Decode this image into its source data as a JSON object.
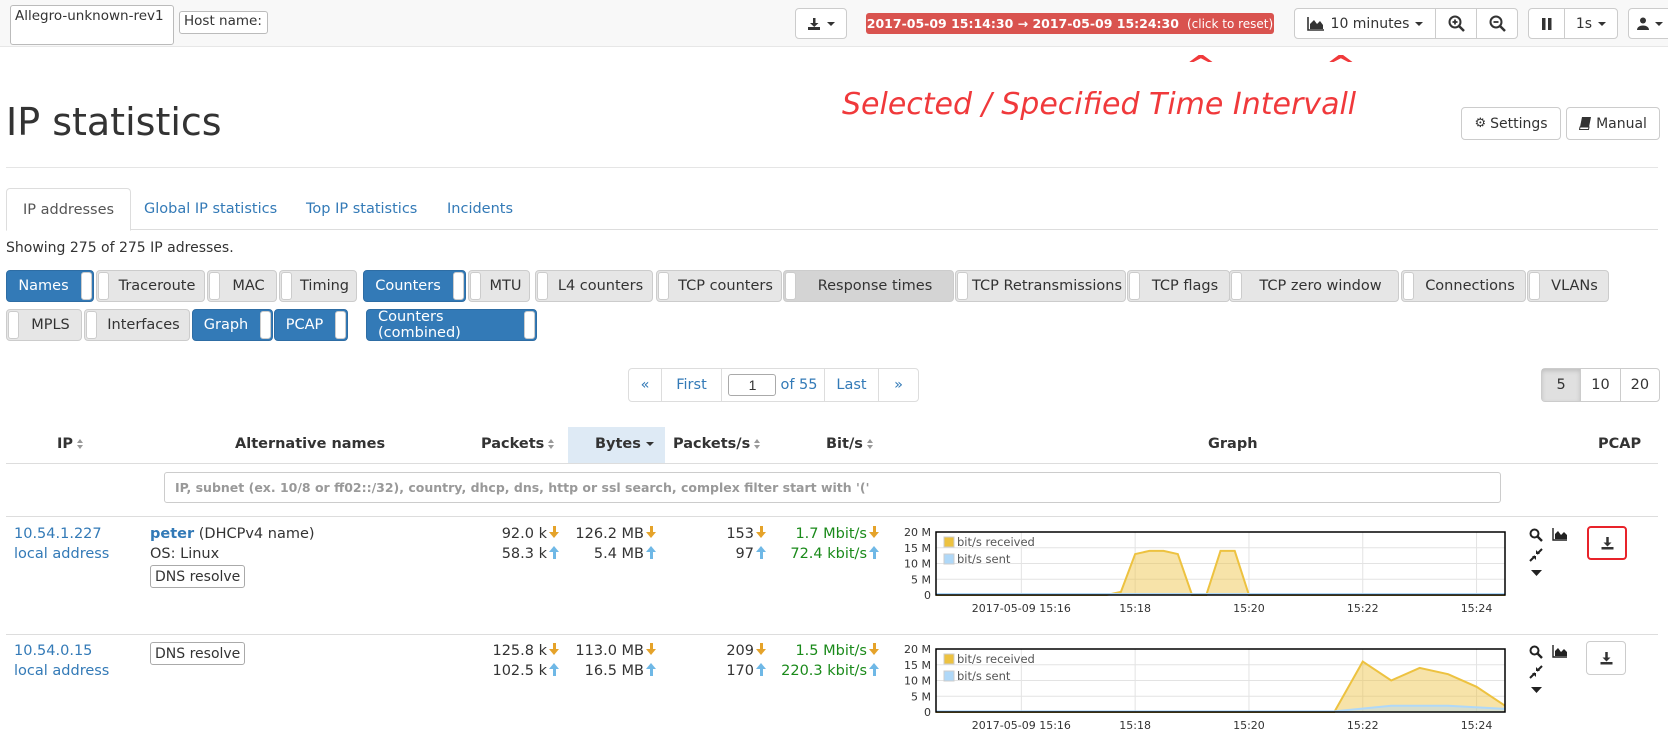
{
  "topbar": {
    "device_name": "Allegro-unknown-rev1",
    "host_name_label": "Host name:",
    "time_range": "2017-05-09 15:14:30 → 2017-05-09 15:24:30",
    "time_range_hint": "(click to reset)",
    "interval_label": "10 minutes",
    "refresh_label": "1s"
  },
  "annotation": {
    "text": "Selected / Specified Time Intervall",
    "caret": "^"
  },
  "header": {
    "title": "IP statistics",
    "settings_label": "Settings",
    "manual_label": "Manual"
  },
  "tabs": [
    {
      "label": "IP addresses",
      "active": true
    },
    {
      "label": "Global IP statistics",
      "active": false
    },
    {
      "label": "Top IP statistics",
      "active": false
    },
    {
      "label": "Incidents",
      "active": false
    }
  ],
  "showing_text": "Showing 275 of 275 IP adresses.",
  "column_toggles": [
    {
      "label": "Names",
      "on": true
    },
    {
      "label": "Traceroute",
      "on": false
    },
    {
      "label": "MAC",
      "on": false
    },
    {
      "label": "Timing",
      "on": false
    },
    {
      "label": "Counters",
      "on": true
    },
    {
      "label": "MTU",
      "on": false
    },
    {
      "label": "L4 counters",
      "on": false
    },
    {
      "label": "TCP counters",
      "on": false
    },
    {
      "label": "Response times",
      "on": false
    },
    {
      "label": "TCP Retransmissions",
      "on": false
    },
    {
      "label": "TCP flags",
      "on": false
    },
    {
      "label": "TCP zero window",
      "on": false
    },
    {
      "label": "Connections",
      "on": false
    },
    {
      "label": "VLANs",
      "on": false
    },
    {
      "label": "MPLS",
      "on": false
    },
    {
      "label": "Interfaces",
      "on": false
    },
    {
      "label": "Graph",
      "on": true
    },
    {
      "label": "PCAP",
      "on": true
    },
    {
      "label": "Counters (combined)",
      "on": true
    }
  ],
  "pagination": {
    "prev": "«",
    "first": "First",
    "current_page": "1",
    "of_text": "of 55",
    "last": "Last",
    "next": "»",
    "page_sizes": [
      "5",
      "10",
      "20"
    ],
    "selected_page_size": "5"
  },
  "table": {
    "headers": {
      "ip": "IP",
      "alt_names": "Alternative names",
      "packets": "Packets",
      "bytes": "Bytes",
      "packets_per_s": "Packets/s",
      "bits_per_s": "Bit/s",
      "graph": "Graph",
      "pcap": "PCAP"
    },
    "filter_placeholder": "IP, subnet (ex. 10/8 or ff02::/32), country, dhcp, dns, http or ssl search, complex filter start with '('",
    "rows": [
      {
        "ip": "10.54.1.227",
        "ip_type": "local address",
        "name": "peter",
        "name_source": "(DHCPv4 name)",
        "os": "OS: Linux",
        "dns_button": "DNS resolve",
        "packets_rx": "92.0 k",
        "packets_tx": "58.3 k",
        "bytes_rx": "126.2 MB",
        "bytes_tx": "5.4 MB",
        "pps_rx": "153",
        "pps_tx": "97",
        "bps_rx": "1.7 Mbit/s",
        "bps_tx": "72.4 kbit/s",
        "pcap_highlighted": true
      },
      {
        "ip": "10.54.0.15",
        "ip_type": "local address",
        "dns_button": "DNS resolve",
        "packets_rx": "125.8 k",
        "packets_tx": "102.5 k",
        "bytes_rx": "113.0 MB",
        "bytes_tx": "16.5 MB",
        "pps_rx": "209",
        "pps_tx": "170",
        "bps_rx": "1.5 Mbit/s",
        "bps_tx": "220.3 kbit/s",
        "pcap_highlighted": false
      }
    ]
  },
  "chart_data": [
    {
      "type": "area",
      "series": [
        {
          "name": "bit/s received",
          "color": "#edc240",
          "x": [
            "15:14:30",
            "15:17:30",
            "15:17:45",
            "15:18:00",
            "15:18:15",
            "15:18:30",
            "15:18:45",
            "15:19:00",
            "15:19:15",
            "15:19:30",
            "15:19:45",
            "15:20:00",
            "15:24:30"
          ],
          "values": [
            0,
            0,
            1,
            13,
            14,
            14,
            13,
            0,
            0,
            14,
            14,
            0,
            0
          ]
        },
        {
          "name": "bit/s sent",
          "color": "#afd8f8",
          "x": [
            "15:14:30",
            "15:24:30"
          ],
          "values": [
            0.3,
            0.3
          ]
        }
      ],
      "yticks": [
        "20 M",
        "15 M",
        "10 M",
        "5 M",
        "0"
      ],
      "xticks": [
        "2017-05-09 15:16",
        "15:18",
        "15:20",
        "15:22",
        "15:24"
      ],
      "ylim": [
        0,
        20
      ],
      "legend": "top-left"
    },
    {
      "type": "area",
      "series": [
        {
          "name": "bit/s received",
          "color": "#edc240",
          "x": [
            "15:14:30",
            "15:21:30",
            "15:22:00",
            "15:22:30",
            "15:23:00",
            "15:23:30",
            "15:24:00",
            "15:24:30"
          ],
          "values": [
            0,
            0,
            16,
            10,
            14,
            12,
            8,
            2
          ]
        },
        {
          "name": "bit/s sent",
          "color": "#afd8f8",
          "x": [
            "15:14:30",
            "15:21:30",
            "15:22:30",
            "15:23:30",
            "15:24:30"
          ],
          "values": [
            0.2,
            0.2,
            2,
            2,
            1
          ]
        }
      ],
      "yticks": [
        "20 M",
        "15 M",
        "10 M",
        "5 M",
        "0"
      ],
      "xticks": [
        "2017-05-09 15:16",
        "15:18",
        "15:20",
        "15:22",
        "15:24"
      ],
      "ylim": [
        0,
        20
      ],
      "legend": "top-left"
    }
  ],
  "colors": {
    "accent": "#337ab7",
    "time_range_bg": "#d9534f",
    "annotation": "#f0393b",
    "received": "#edc240",
    "sent": "#afd8f8",
    "rate_text": "#1a8a1a"
  }
}
